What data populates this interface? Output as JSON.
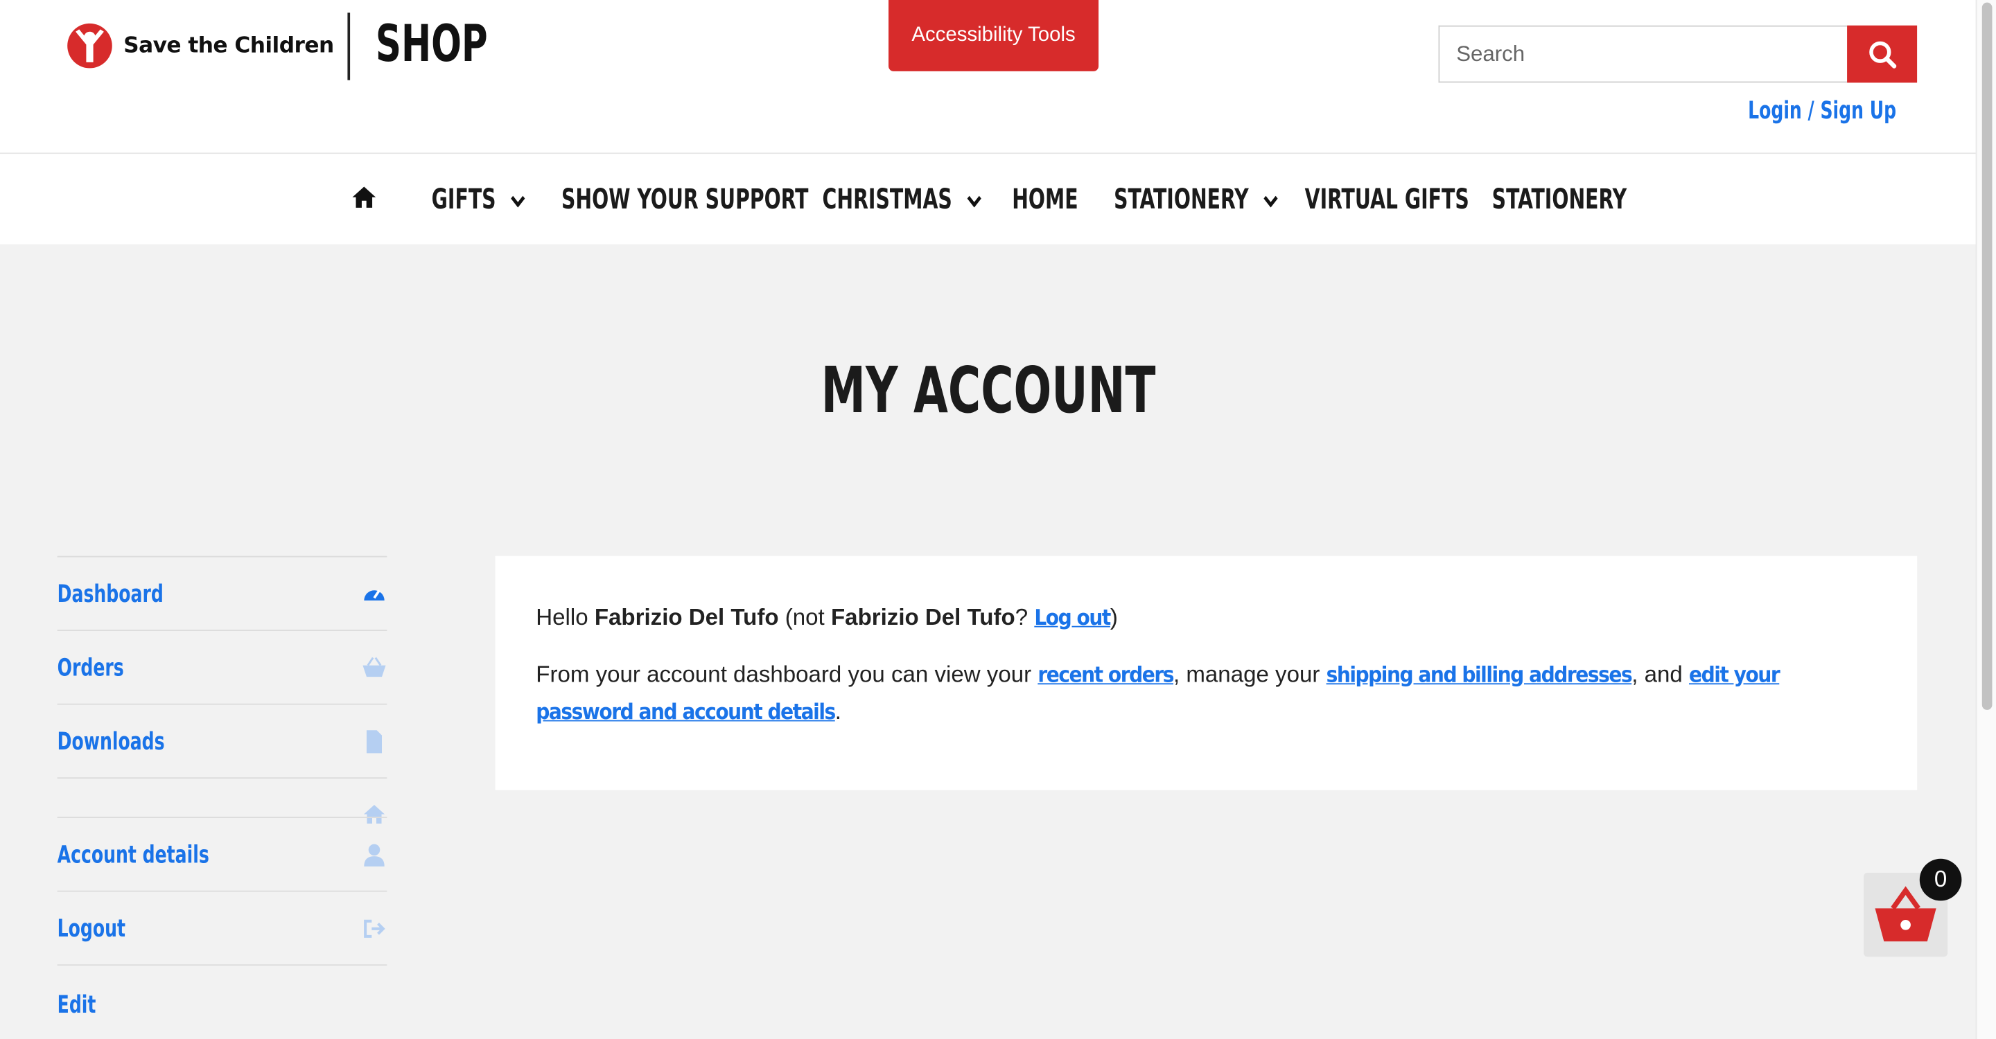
{
  "header": {
    "brand_name": "Save the Children",
    "shop_title": "SHOP",
    "accessibility_label": "Accessibility Tools",
    "search_placeholder": "Search",
    "login_label": "Login / Sign Up"
  },
  "nav": {
    "items": [
      {
        "label": "GIFTS",
        "has_dropdown": true
      },
      {
        "label": "SHOW YOUR SUPPORT",
        "has_dropdown": false
      },
      {
        "label": "CHRISTMAS",
        "has_dropdown": true
      },
      {
        "label": "HOME",
        "has_dropdown": false
      },
      {
        "label": "STATIONERY",
        "has_dropdown": true
      },
      {
        "label": "VIRTUAL GIFTS",
        "has_dropdown": false
      },
      {
        "label": "STATIONERY",
        "has_dropdown": false
      }
    ]
  },
  "page": {
    "title": "MY ACCOUNT"
  },
  "sidebar": {
    "items": [
      {
        "label": "Dashboard",
        "icon": "dashboard-icon",
        "active": true
      },
      {
        "label": "Orders",
        "icon": "basket-icon"
      },
      {
        "label": "Downloads",
        "icon": "file-icon"
      },
      {
        "label": "",
        "icon": "home-icon"
      },
      {
        "label": "Account details",
        "icon": "user-icon"
      },
      {
        "label": "Logout",
        "icon": "logout-icon"
      },
      {
        "label": "Edit",
        "icon": ""
      }
    ]
  },
  "content": {
    "hello": "Hello",
    "user_name": "Fabrizio Del Tufo",
    "not_prefix": "(not",
    "user_name_2": "Fabrizio Del Tufo",
    "question": "?",
    "logout_link": "Log out",
    "close_paren": ")",
    "intro": "From your account dashboard you can view your",
    "recent_orders_link": "recent orders",
    "manage": ", manage your",
    "addresses_link": "shipping and billing addresses",
    "and": ", and",
    "edit_link": "edit your password and account details",
    "period": "."
  },
  "cart": {
    "count": "0"
  },
  "colors": {
    "accent_red": "#d72b2b",
    "link_blue": "#1a73e8",
    "background": "#f2f2f2"
  }
}
